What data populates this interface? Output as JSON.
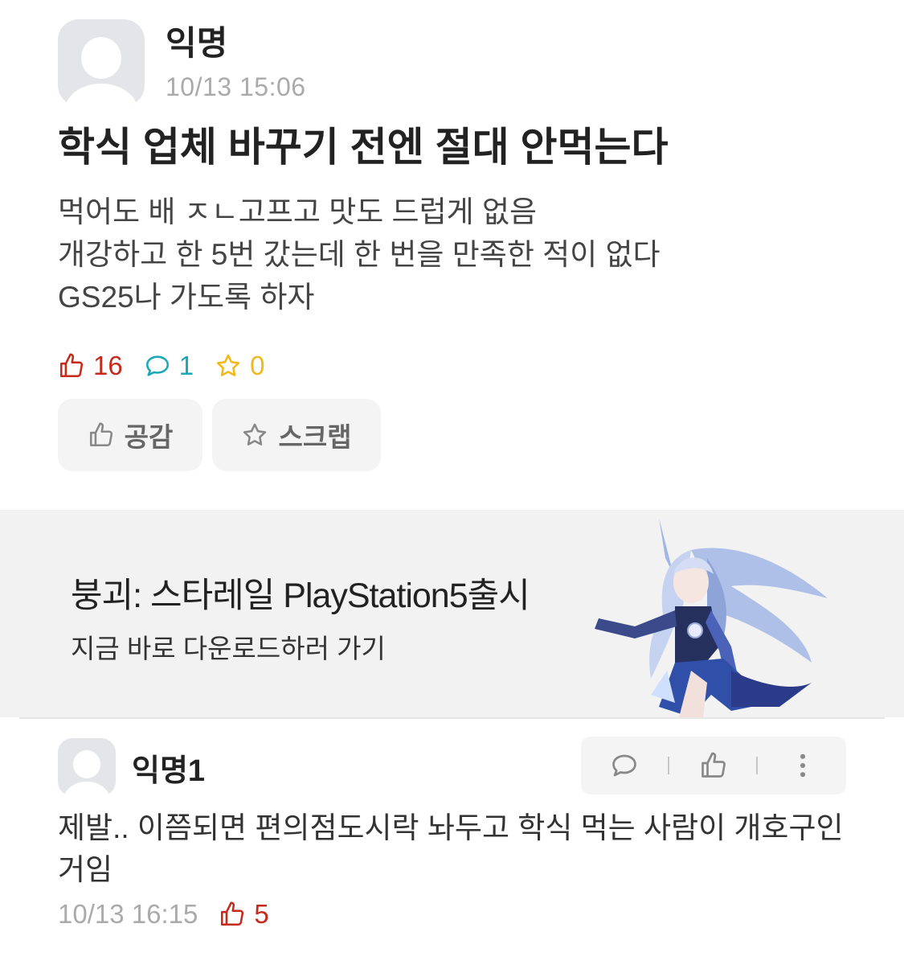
{
  "post": {
    "author": "익명",
    "time": "10/13 15:06",
    "title": "학식 업체 바꾸기 전엔 절대 안먹는다",
    "body_lines": [
      "먹어도 배 ㅈㄴ고프고 맛도 드럽게 없음",
      "개강하고 한 5번 갔는데 한 번을 만족한 적이 없다",
      "GS25나 가도록 하자"
    ],
    "stats": {
      "likes": "16",
      "comments": "1",
      "scraps": "0"
    }
  },
  "actions": {
    "like_label": "공감",
    "scrap_label": "스크랩"
  },
  "ad": {
    "title": "붕괴: 스타레일 PlayStation5출시",
    "subtitle": "지금 바로 다운로드하러 가기"
  },
  "comment": {
    "author": "익명1",
    "text": "제발.. 이쯤되면 편의점도시락 놔두고 학식 먹는 사람이 개호구인거임",
    "time": "10/13 16:15",
    "likes": "5"
  },
  "colors": {
    "like": "#c62a1a",
    "comment": "#1aa8b8",
    "scrap": "#f2b81a",
    "muted": "#aaaaaa"
  },
  "icons": [
    "thumbs-up-icon",
    "comment-bubble-icon",
    "star-icon",
    "more-vertical-icon"
  ]
}
